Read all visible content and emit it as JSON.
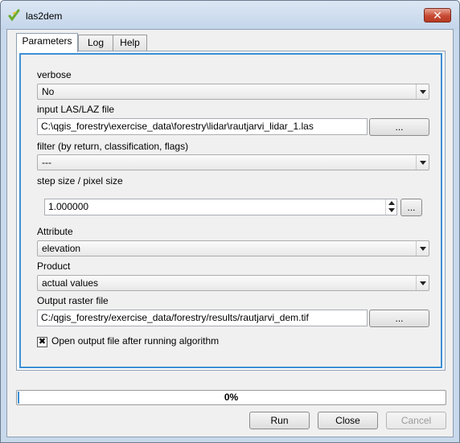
{
  "window": {
    "title": "las2dem",
    "close_label": "✕"
  },
  "tabs": [
    {
      "label": "Parameters",
      "active": true
    },
    {
      "label": "Log",
      "active": false
    },
    {
      "label": "Help",
      "active": false
    }
  ],
  "params": {
    "verbose": {
      "label": "verbose",
      "value": "No"
    },
    "input": {
      "label": "input LAS/LAZ file",
      "value": "C:\\qgis_forestry\\exercise_data\\forestry\\lidar\\rautjarvi_lidar_1.las",
      "browse_label": "..."
    },
    "filter": {
      "label": "filter (by return, classification, flags)",
      "value": "---"
    },
    "step": {
      "label": "step size / pixel size",
      "value": "1.000000",
      "browse_label": "..."
    },
    "attribute": {
      "label": "Attribute",
      "value": "elevation"
    },
    "product": {
      "label": "Product",
      "value": "actual values"
    },
    "output": {
      "label": "Output raster file",
      "value": "C:/qgis_forestry/exercise_data/forestry/results/rautjarvi_dem.tif",
      "browse_label": "..."
    },
    "open_output": {
      "label": "Open output file after running algorithm",
      "checked": true,
      "mark": "✖"
    }
  },
  "progress": {
    "value": 0,
    "text": "0%"
  },
  "buttons": {
    "run": "Run",
    "close": "Close",
    "cancel": "Cancel"
  },
  "colors": {
    "accent": "#3c8fd4",
    "titlebar": "#c9d9ec",
    "close_button": "#c74a33"
  },
  "icons": {
    "app": "qgis-icon"
  }
}
